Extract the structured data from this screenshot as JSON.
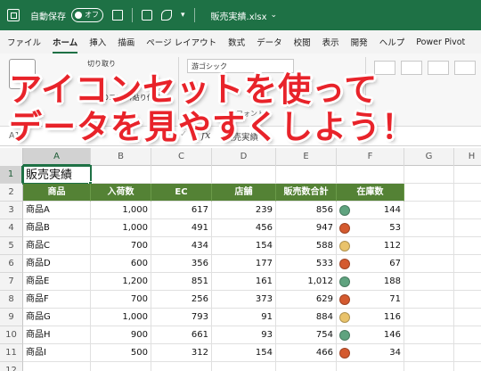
{
  "titlebar": {
    "autosave_label": "自動保存",
    "autosave_state": "オフ",
    "filename": "販売実績.xlsx",
    "filename_caret": "⌄"
  },
  "ribbon_tabs": [
    "ファイル",
    "ホーム",
    "挿入",
    "描画",
    "ページ レイアウト",
    "数式",
    "データ",
    "校閲",
    "表示",
    "開発",
    "ヘルプ",
    "Power Pivot"
  ],
  "active_tab": "ホーム",
  "ribbon": {
    "cut_label": "切り取り",
    "copy_label": "コピ",
    "format_painter_label": "書式のコピー/貼り付け",
    "font_name_partial": "游ゴシック",
    "font_label_partial": "フォント"
  },
  "banner": {
    "line1": "アイコンセットを使って",
    "line2": "データを見やすくしよう！"
  },
  "formula_bar": {
    "name_box": "A1",
    "fx": "fx",
    "content": "販売実績"
  },
  "columns": [
    "A",
    "B",
    "C",
    "D",
    "E",
    "F",
    "G",
    "H"
  ],
  "selected_column": "A",
  "rows": [
    "1",
    "2",
    "3",
    "4",
    "5",
    "6",
    "7",
    "8",
    "9",
    "10",
    "11",
    "12"
  ],
  "selected_row": "1",
  "sheet": {
    "title": "販売実績",
    "headers": [
      "商品",
      "入荷数",
      "EC",
      "店舗",
      "販売数合計",
      "在庫数"
    ],
    "records": [
      {
        "name": "商品A",
        "incoming": "1,000",
        "ec": "617",
        "store": "239",
        "total": "856",
        "stock": "144",
        "icon": "green-circle-icon"
      },
      {
        "name": "商品B",
        "incoming": "1,000",
        "ec": "491",
        "store": "456",
        "total": "947",
        "stock": "53",
        "icon": "red-circle-icon"
      },
      {
        "name": "商品C",
        "incoming": "700",
        "ec": "434",
        "store": "154",
        "total": "588",
        "stock": "112",
        "icon": "yellow-circle-icon"
      },
      {
        "name": "商品D",
        "incoming": "600",
        "ec": "356",
        "store": "177",
        "total": "533",
        "stock": "67",
        "icon": "red-circle-icon"
      },
      {
        "name": "商品E",
        "incoming": "1,200",
        "ec": "851",
        "store": "161",
        "total": "1,012",
        "stock": "188",
        "icon": "green-circle-icon"
      },
      {
        "name": "商品F",
        "incoming": "700",
        "ec": "256",
        "store": "373",
        "total": "629",
        "stock": "71",
        "icon": "red-circle-icon"
      },
      {
        "name": "商品G",
        "incoming": "1,000",
        "ec": "793",
        "store": "91",
        "total": "884",
        "stock": "116",
        "icon": "yellow-circle-icon"
      },
      {
        "name": "商品H",
        "incoming": "900",
        "ec": "661",
        "store": "93",
        "total": "754",
        "stock": "146",
        "icon": "green-circle-icon"
      },
      {
        "name": "商品I",
        "incoming": "500",
        "ec": "312",
        "store": "154",
        "total": "466",
        "stock": "34",
        "icon": "red-circle-icon"
      }
    ]
  },
  "colors": {
    "excel_green": "#1e7145",
    "table_header": "#548235",
    "banner_text": "#e8232a",
    "icon_green": "#5fa37f",
    "icon_yellow": "#e9c36b",
    "icon_red": "#d45a2f"
  }
}
